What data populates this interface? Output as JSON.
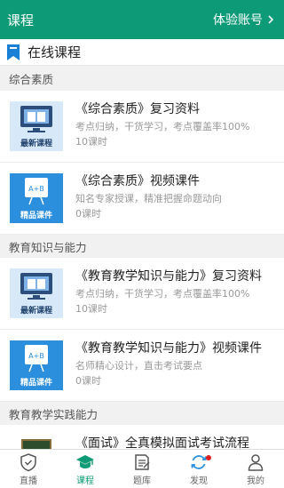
{
  "header": {
    "title": "课程",
    "account_label": "体验账号"
  },
  "section": {
    "title": "在线课程"
  },
  "categories": [
    {
      "name": "综合素质",
      "courses": [
        {
          "badge": "最新课程",
          "title": "《综合素质》复习资料",
          "desc": "考点归纳，干货学习，考点覆盖率100%",
          "hours": "10课时"
        },
        {
          "badge": "精品课件",
          "title": "《综合素质》视频课件",
          "desc": "知名专家授课，精准把握命题动向",
          "hours": "0课时"
        }
      ]
    },
    {
      "name": "教育知识与能力",
      "courses": [
        {
          "badge": "最新课程",
          "title": "《教育教学知识与能力》复习资料",
          "desc": "考点归纳，干货学习，考点覆盖率100%",
          "hours": "10课时"
        },
        {
          "badge": "精品课件",
          "title": "《教育教学知识与能力》视频课件",
          "desc": "名师精心设计，直击考试要点",
          "hours": "0课时"
        }
      ]
    },
    {
      "name": "教育教学实践能力",
      "courses": [
        {
          "title": "《面试》全真模拟面试考试流程"
        }
      ]
    }
  ],
  "tabs": [
    {
      "label": "直播",
      "icon": "shield-icon"
    },
    {
      "label": "课程",
      "icon": "graduation-cap-icon",
      "active": true
    },
    {
      "label": "题库",
      "icon": "notebook-icon"
    },
    {
      "label": "发现",
      "icon": "refresh-icon",
      "dot": true
    },
    {
      "label": "我的",
      "icon": "user-icon"
    }
  ],
  "colors": {
    "primary": "#0d9a76",
    "badge_blue": "#2b8fde",
    "notify_dot": "#e02020"
  }
}
